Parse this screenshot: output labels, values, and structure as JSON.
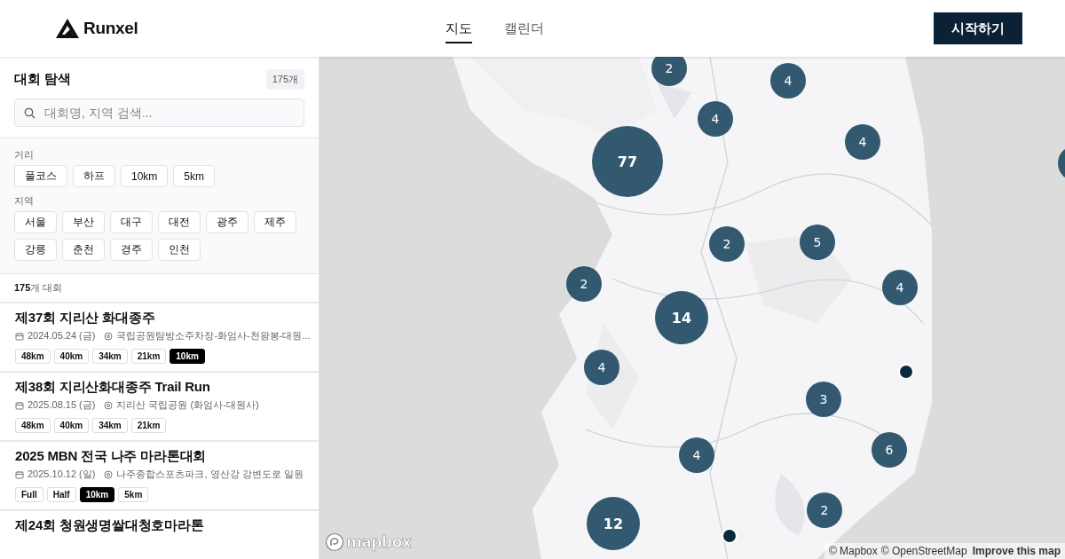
{
  "header": {
    "logo": "Runxel",
    "tabs": [
      {
        "label": "지도",
        "selected": true
      },
      {
        "label": "캘린더",
        "selected": false
      }
    ],
    "cta": "시작하기"
  },
  "sidebar": {
    "title": "대회 탐색",
    "count_badge": "175개",
    "search": {
      "placeholder": "대회명, 지역 검색..."
    },
    "filters": [
      {
        "label": "거리",
        "options": [
          {
            "label": "풀코스",
            "selected": false
          },
          {
            "label": "하프",
            "selected": false
          },
          {
            "label": "10km",
            "selected": false
          },
          {
            "label": "5km",
            "selected": false
          }
        ]
      },
      {
        "label": "지역",
        "options": [
          {
            "label": "서울",
            "selected": false
          },
          {
            "label": "부산",
            "selected": false
          },
          {
            "label": "대구",
            "selected": false
          },
          {
            "label": "대전",
            "selected": false
          },
          {
            "label": "광주",
            "selected": false
          },
          {
            "label": "제주",
            "selected": false
          },
          {
            "label": "강릉",
            "selected": false
          },
          {
            "label": "춘천",
            "selected": false
          },
          {
            "label": "경주",
            "selected": false
          },
          {
            "label": "인천",
            "selected": false
          }
        ]
      }
    ],
    "result_count": "**175**개 대회",
    "races": [
      {
        "title": "제37회 지리산 화대종주",
        "date": "2024.05.24 (금)",
        "location": "국립공원탐방소주차장-화엄사-천왕봉-대원...",
        "tags": [
          {
            "label": "48km",
            "highlighted": false
          },
          {
            "label": "40km",
            "highlighted": false
          },
          {
            "label": "34km",
            "highlighted": false
          },
          {
            "label": "21km",
            "highlighted": false
          },
          {
            "label": "10km",
            "highlighted": true
          }
        ]
      },
      {
        "title": "제38회 지리산화대종주 Trail Run",
        "date": "2025.08.15 (금)",
        "location": "지리산 국립공원 (화엄사-대원사)",
        "tags": [
          {
            "label": "48km",
            "highlighted": false
          },
          {
            "label": "40km",
            "highlighted": false
          },
          {
            "label": "34km",
            "highlighted": false
          },
          {
            "label": "21km",
            "highlighted": false
          }
        ]
      },
      {
        "title": "2025 MBN 전국 나주 마라톤대회",
        "date": "2025.10.12 (일)",
        "location": "나주종합스포츠파크, 영산강 강변도로 일원",
        "tags": [
          {
            "label": "Full",
            "highlighted": false
          },
          {
            "label": "Half",
            "highlighted": false
          },
          {
            "label": "10km",
            "highlighted": true
          },
          {
            "label": "5km",
            "highlighted": false
          }
        ]
      },
      {
        "title": "제24회 청원생명쌀대청호마라톤"
      }
    ]
  },
  "map": {
    "markers": [
      {
        "kind": "cluster",
        "count": "2"
      },
      {
        "kind": "cluster",
        "count": "4"
      },
      {
        "kind": "cluster",
        "count": "4"
      },
      {
        "kind": "cluster",
        "count": "77"
      },
      {
        "kind": "cluster",
        "count": "4"
      },
      {
        "kind": "cluster"
      },
      {
        "kind": "cluster",
        "count": "2"
      },
      {
        "kind": "cluster",
        "count": "5"
      },
      {
        "kind": "cluster",
        "count": "2"
      },
      {
        "kind": "cluster",
        "count": "4"
      },
      {
        "kind": "cluster",
        "count": "14"
      },
      {
        "kind": "cluster",
        "count": "4"
      },
      {
        "kind": "point"
      },
      {
        "kind": "cluster",
        "count": "3"
      },
      {
        "kind": "cluster",
        "count": "6"
      },
      {
        "kind": "cluster",
        "count": "4"
      },
      {
        "kind": "cluster",
        "count": "2"
      },
      {
        "kind": "cluster",
        "count": "12"
      },
      {
        "kind": "point"
      }
    ],
    "logo": "mapbox",
    "attribution": [
      "© Mapbox",
      "© OpenStreetMap",
      "Improve this map"
    ]
  }
}
